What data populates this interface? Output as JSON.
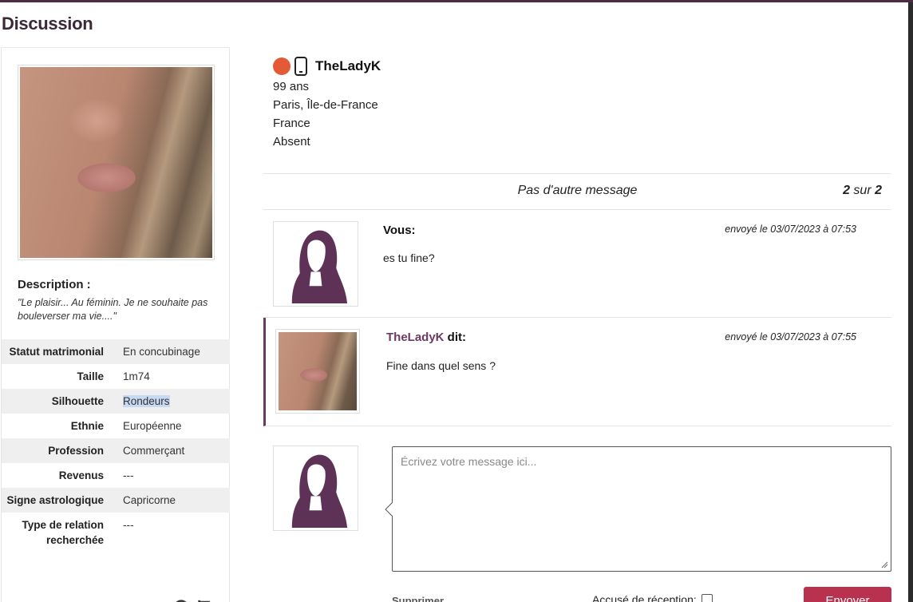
{
  "page": {
    "title": "Discussion"
  },
  "profile": {
    "description_title": "Description :",
    "description_text": "\"Le plaisir... Au féminin. Je ne souhaite pas bouleverser ma vie....\"",
    "attributes": [
      {
        "label": "Statut matrimonial",
        "value": "En concubinage"
      },
      {
        "label": "Taille",
        "value": "1m74"
      },
      {
        "label": "Silhouette",
        "value": "Rondeurs"
      },
      {
        "label": "Ethnie",
        "value": "Européenne"
      },
      {
        "label": "Profession",
        "value": "Commerçant"
      },
      {
        "label": "Revenus",
        "value": "---"
      },
      {
        "label": "Signe astrologique",
        "value": "Capricorne"
      },
      {
        "label": "Type de relation recherchée",
        "value": "---"
      }
    ],
    "icons": [
      "history-icon",
      "flag-icon"
    ]
  },
  "contact": {
    "name": "TheLadyK",
    "age": "99 ans",
    "city": "Paris, Île-de-France",
    "country": "France",
    "status": "Absent",
    "status_color": "#e35b35"
  },
  "messages_bar": {
    "no_more": "Pas d'autre message",
    "page_current": "2",
    "page_sep": " sur ",
    "page_total": "2"
  },
  "messages": [
    {
      "author": "Vous:",
      "date": "envoyé le 03/07/2023 à 07:53",
      "text": "es tu fine?"
    },
    {
      "author_name": "TheLadyK",
      "author_suffix": " dit:",
      "date": "envoyé le 03/07/2023 à 07:55",
      "text": "Fine dans quel sens ?"
    }
  ],
  "compose": {
    "placeholder": "Écrivez votre message ici...",
    "delete_label": "Supprimer",
    "receipt_label": "Accusé de réception:",
    "send_label": "Envoyer"
  },
  "colors": {
    "accent": "#6b3a63",
    "send": "#b8324f",
    "header_border": "#4a2c44"
  }
}
